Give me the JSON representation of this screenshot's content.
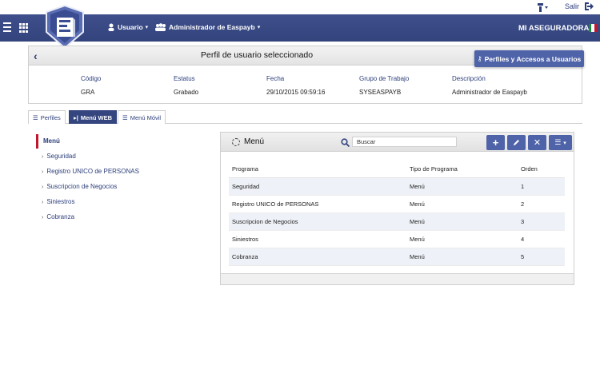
{
  "top_bar": {
    "salir_label": "Salir"
  },
  "navbar": {
    "usuario_label": "Usuario",
    "admin_label": "Administrador de Easpayb",
    "brand": "MI ASEGURADORA"
  },
  "profile": {
    "title": "Perfil de usuario seleccionado",
    "perfiles_button": "Perfiles y Accesos a Usuarios",
    "fields": [
      {
        "label": "Código",
        "value": "GRA"
      },
      {
        "label": "Estatus",
        "value": "Grabado"
      },
      {
        "label": "Fecha",
        "value": "29/10/2015 09:59:16"
      },
      {
        "label": "Grupo de Trabajo",
        "value": "SYSEASPAYB"
      },
      {
        "label": "Descripción",
        "value": "Administrador de Easpayb"
      }
    ]
  },
  "tabs": [
    {
      "label": "Perfiles",
      "icon": "list-icon"
    },
    {
      "label": "Menú WEB",
      "icon": "web-icon",
      "active": true
    },
    {
      "label": "Menú Móvil",
      "icon": "list-icon"
    }
  ],
  "tree": {
    "root": "Menú",
    "items": [
      "Seguridad",
      "Registro UNICO de PERSONAS",
      "Suscripcion de Negocios",
      "Siniestros",
      "Cobranza"
    ]
  },
  "menu_panel": {
    "title": "Menú",
    "search_placeholder": "Buscar",
    "columns": [
      "Programa",
      "Tipo de Programa",
      "Orden"
    ],
    "rows": [
      [
        "Seguridad",
        "Menú",
        "1"
      ],
      [
        "Registro UNICO de PERSONAS",
        "Menú",
        "2"
      ],
      [
        "Suscripcion de Negocios",
        "Menú",
        "3"
      ],
      [
        "Siniestros",
        "Menú",
        "4"
      ],
      [
        "Cobranza",
        "Menú",
        "5"
      ]
    ]
  },
  "colors": {
    "navbar": "#3a4a86",
    "accent": "#4f63a9",
    "active_marker": "#c0182a"
  }
}
